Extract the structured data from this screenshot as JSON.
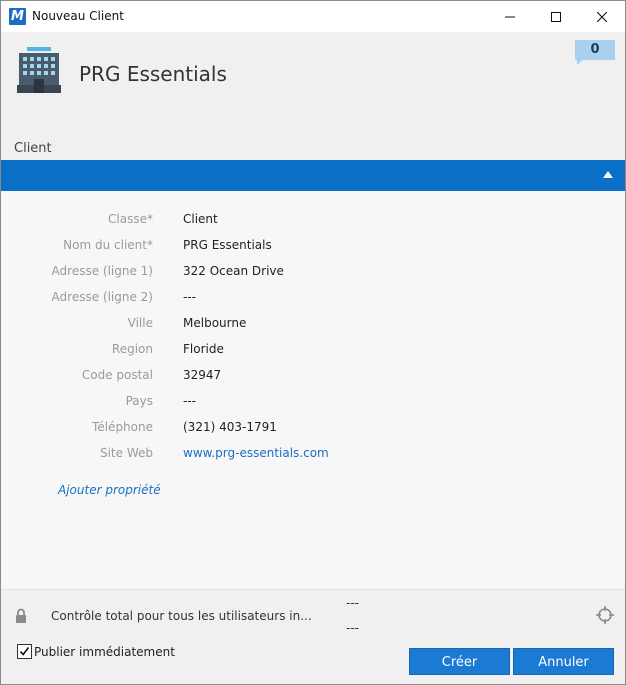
{
  "window": {
    "title": "Nouveau Client",
    "app_icon_letter": "M"
  },
  "header": {
    "client_name": "PRG Essentials",
    "comment_count": "0",
    "section_tab": "Client"
  },
  "form": {
    "fields": [
      {
        "label": "Classe*",
        "value": "Client"
      },
      {
        "label": "Nom du client*",
        "value": "PRG Essentials"
      },
      {
        "label": "Adresse (ligne 1)",
        "value": "322 Ocean Drive"
      },
      {
        "label": "Adresse (ligne 2)",
        "value": "---"
      },
      {
        "label": "Ville",
        "value": "Melbourne"
      },
      {
        "label": "Region",
        "value": "Floride"
      },
      {
        "label": "Code postal",
        "value": "32947"
      },
      {
        "label": "Pays",
        "value": "---"
      },
      {
        "label": "Téléphone",
        "value": "(321) 403-1791"
      },
      {
        "label": "Site Web",
        "value": "www.prg-essentials.com"
      }
    ],
    "add_property": "Ajouter propriété"
  },
  "permissions": {
    "text": "Contrôle total pour tous les utilisateurs in...",
    "line1": "---",
    "line2": "---"
  },
  "footer": {
    "publish_label": "Publier immédiatement",
    "publish_checked": true,
    "create_label": "Créer",
    "cancel_label": "Annuler"
  },
  "colors": {
    "accent": "#0a6fc6",
    "button": "#1a7ad4",
    "link": "#1a6fc4",
    "badge": "#a9d1ef"
  },
  "icons": [
    "app-logo-icon",
    "minimize-icon",
    "maximize-icon",
    "close-icon",
    "building-icon",
    "comment-icon",
    "collapse-up-icon",
    "lock-icon",
    "target-icon",
    "checkbox-check-icon"
  ]
}
